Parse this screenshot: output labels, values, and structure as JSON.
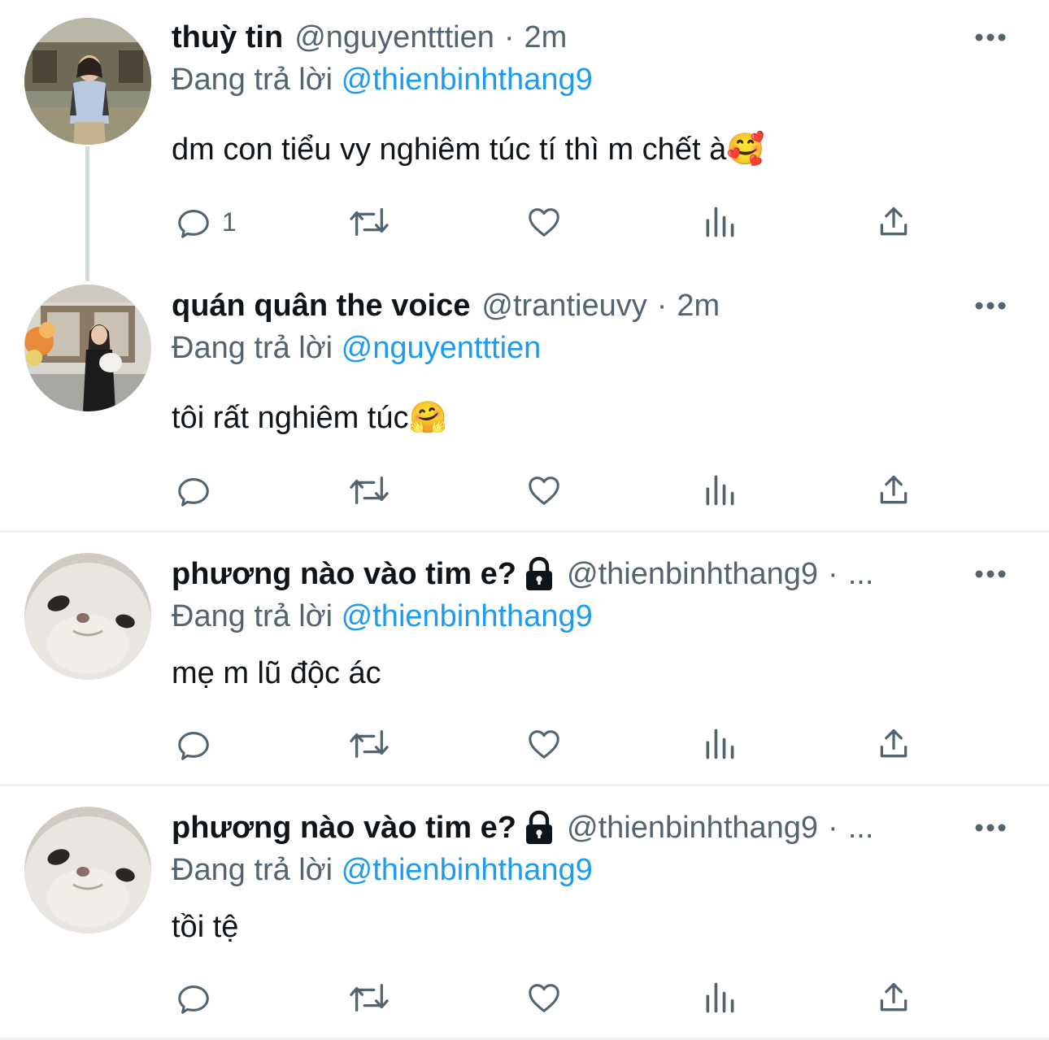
{
  "tweets": [
    {
      "name": "thuỳ tin",
      "handle": "@nguyentttien",
      "dot": "·",
      "time": "2m",
      "reply_prefix": "Đang trả lời",
      "reply_to": "@thienbinhthang9",
      "text": "dm con tiểu vy nghiêm túc tí thì m chết à🥰",
      "reply_count": "1"
    },
    {
      "name": "quán quân the voice",
      "handle": "@trantieuvy",
      "dot": "·",
      "time": "2m",
      "reply_prefix": "Đang trả lời",
      "reply_to": "@nguyentttien",
      "text": "tôi rất nghiêm túc🤗",
      "reply_count": ""
    },
    {
      "name": "phương nào vào tim e?",
      "handle": "@thienbinhthang9",
      "dot": "·",
      "time": "...",
      "reply_prefix": "Đang trả lời",
      "reply_to": "@thienbinhthang9",
      "text": "mẹ m lũ độc ác",
      "reply_count": ""
    },
    {
      "name": "phương nào vào tim e?",
      "handle": "@thienbinhthang9",
      "dot": "·",
      "time": "...",
      "reply_prefix": "Đang trả lời",
      "reply_to": "@thienbinhthang9",
      "text": "tồi tệ",
      "reply_count": ""
    }
  ],
  "icons": {
    "more": "more-icon",
    "reply": "reply-icon",
    "retweet": "retweet-icon",
    "like": "heart-icon",
    "views": "views-icon",
    "share": "share-icon",
    "lock": "lock-icon"
  },
  "colors": {
    "text": "#0f1419",
    "secondary": "#536471",
    "link": "#1d9bf0",
    "divider": "#eff3f4",
    "thread_line": "#cfd9de"
  }
}
